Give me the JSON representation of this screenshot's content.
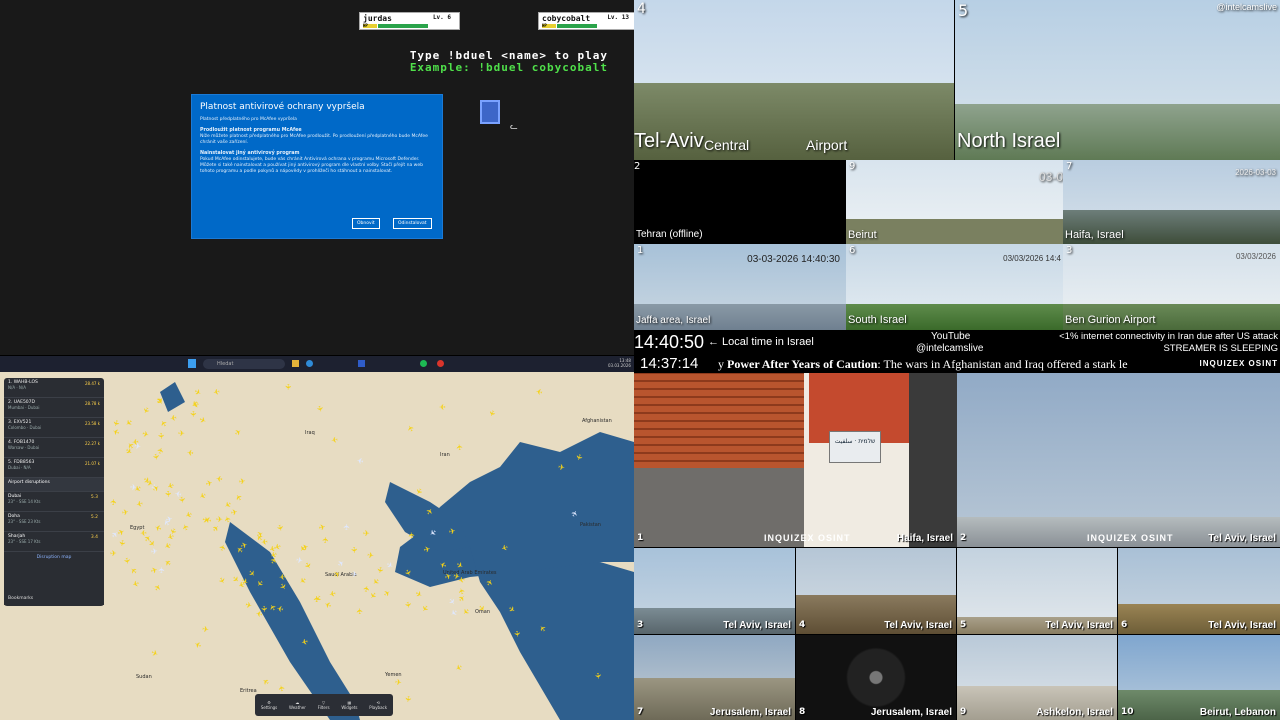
{
  "game": {
    "player1": {
      "name": "jurdas",
      "level": "Lv. 6",
      "hp": "HP"
    },
    "player2": {
      "name": "cobycobalt",
      "level": "Lv. 13",
      "hp": "HP"
    },
    "instruction": "Type !bduel <name> to play",
    "example": "Example: !bduel cobycobalt"
  },
  "mcafee": {
    "title": "Platnost antivirové ochrany vypršela",
    "subtitle": "Platnost předplatného pro McAfee vypršela",
    "section1_title": "Prodloužit platnost programu McAfee",
    "section1_text": "Níže můžete platnost předplatného pro McAfee prodloužit. Po prodloužení předplatného bude McAfee chránit vaše zařízení.",
    "section2_title": "Nainstalovat jiný antivirový program",
    "section2_text": "Pokud McAfee odinstalujete, bude vás chránit Antivirová ochrana v programu Microsoft Defender. Můžete si také nainstalovat a používat jiný antivirový program dle vlastní volby. Stačí přejít na web tohoto programu a podle pokynů a nápovědy v prohlížeči ho stáhnout a nainstalovat.",
    "renew_button": "Obnovit",
    "uninstall_button": "Odinstalovat"
  },
  "taskbar": {
    "search_placeholder": "Hledat",
    "time": "13:48",
    "date": "03.03.2026"
  },
  "flights": {
    "list": [
      {
        "code": "1. WAHB-LOS",
        "sub": "N/A · N/A",
        "val": "28.47 k"
      },
      {
        "code": "2. UAE507D",
        "sub": "Mumbai · Dubai",
        "val": "28.78 k"
      },
      {
        "code": "3. EXV521",
        "sub": "Colombo · Dubai",
        "val": "23.58 k"
      },
      {
        "code": "4. FOB1470",
        "sub": "Warsaw · Dubai",
        "val": "22.27 k"
      },
      {
        "code": "5. FDB8563",
        "sub": "Dubai · N/A",
        "val": "21.07 k"
      }
    ],
    "airport_header": "Airport disruptions",
    "airports": [
      {
        "name": "Dubai",
        "temp": "23°",
        "wind": "SSE 14 Kts",
        "score": "5.3"
      },
      {
        "name": "Doha",
        "temp": "23°",
        "wind": "SSE 23 Kts",
        "score": "5.2"
      },
      {
        "name": "Sharjah",
        "temp": "23°",
        "wind": "SSE 17 Kts",
        "score": "3.4"
      }
    ],
    "disruption_map": "Disruption map",
    "bookmarks": "Bookmarks",
    "bar": [
      "Settings",
      "Weather",
      "Filters",
      "Widgets",
      "Playback"
    ],
    "countries": [
      "Egypt",
      "Iraq",
      "Iran",
      "Sudan",
      "Eritrea",
      "Afghanistan",
      "Pakistan",
      "Saudi Arabia",
      "Oman",
      "Yemen",
      "United Arab Emirates"
    ]
  },
  "cams_top": [
    {
      "num": "4",
      "label": "Tel-Aviv",
      "sub1": "Central",
      "sub2": "Airport"
    },
    {
      "num": "5",
      "label": "North Israel",
      "watermark": "@intelcamslive"
    },
    {
      "num": "2",
      "label": "Tehran (offline)"
    },
    {
      "num": "9",
      "label": "Beirut",
      "stamp": "03-0"
    },
    {
      "num": "7",
      "label": "Haifa, Israel",
      "stamp": "2026-03-03"
    },
    {
      "num": "1",
      "label": "Jaffa area, Israel",
      "stamp": "03-03-2026 14:40:30"
    },
    {
      "num": "6",
      "label": "South Israel",
      "stamp": "03/03/2026 14:4"
    },
    {
      "num": "3",
      "label": "Ben Gurion Airport",
      "stamp": "03/03/2026"
    }
  ],
  "info": {
    "time1": "14:40:50",
    "time1_label": "← Local time in Israel",
    "yt": "YouTube",
    "handle": "@intelcamslive",
    "alert": "<1% internet connectivity in Iran due after US attack",
    "sleep": "STREAMER IS SLEEPING",
    "time2": "14:37:14",
    "ticker_lead": "y",
    "ticker_bold": "Power After Years of Caution",
    "ticker_text": ": The wars in Afghanistan and Iraq offered a stark le",
    "ticker_logo": "INQUIZEX OSINT"
  },
  "cams_bottom": [
    {
      "num": "1",
      "label": "Haifa, Israel",
      "sign": "שלמית · سلفيت"
    },
    {
      "num": "2",
      "label": "Tel Aviv, Israel"
    },
    {
      "num": "3",
      "label": "Tel Aviv, Israel"
    },
    {
      "num": "4",
      "label": "Tel Aviv, Israel"
    },
    {
      "num": "5",
      "label": "Tel Aviv, Israel"
    },
    {
      "num": "6",
      "label": "Tel Aviv, Israel"
    },
    {
      "num": "7",
      "label": "Jerusalem, Israel"
    },
    {
      "num": "8",
      "label": "Jerusalem, Israel"
    },
    {
      "num": "9",
      "label": "Ashkelon, Israel"
    },
    {
      "num": "10",
      "label": "Beirut, Lebanon"
    }
  ],
  "logo": "INQUIZEX OSINT"
}
